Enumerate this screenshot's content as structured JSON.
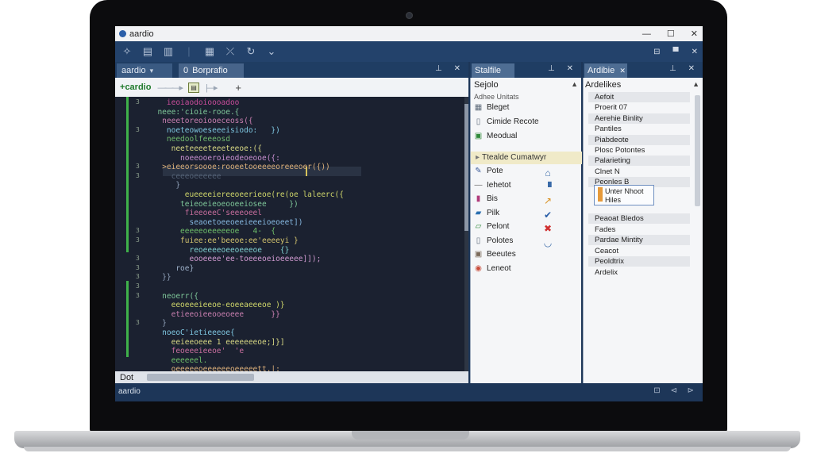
{
  "window": {
    "title": "aardio",
    "minimize": "—",
    "maximize": "☐",
    "close": "✕"
  },
  "toolbar": {
    "pin": "⊟",
    "restore": "▀",
    "close": "✕"
  },
  "editor": {
    "tabs": [
      {
        "label": "aardio",
        "marker": "▾"
      },
      {
        "label": "Borprafio",
        "marker": "0"
      }
    ],
    "pins": "⊥ ✕",
    "tool_label": "cardio",
    "footer_label": "Dot",
    "status_label": "aardio",
    "code_lines": [
      {
        "t": "    ieoiaodoioooadoo",
        "c": "#c94c9a"
      },
      {
        "t": "  neee:'cioie-rooe.{",
        "c": "#7fc89a"
      },
      {
        "t": "   neeetoreoiooeceoss({",
        "c": "#c97fb0"
      },
      {
        "t": "    noeteowoeseeeisiodo:   })",
        "c": "#7ec6e0"
      },
      {
        "t": "    needoolfeeeosd",
        "c": "#6fb86e"
      },
      {
        "t": "     neeteeeeteeeteeoe:({",
        "c": "#d8d884"
      },
      {
        "t": "       noeeooeroieodeoeooe({:",
        "c": "#c98fd0"
      },
      {
        "t": "   >eieeorsoooe:rooeetooeeeeoreeeoer({))",
        "c": "#dcb07a"
      },
      {
        "t": "     ceeeoeeeeee",
        "c": "#566478"
      },
      {
        "t": "      }",
        "c": "#8fa0b8"
      },
      {
        "t": "        eueeeeiereeoeerieoe(re(oe laleerc({",
        "c": "#cfd66a"
      },
      {
        "t": "       teieoeieoeooeeiosee     })",
        "c": "#7fc89a"
      },
      {
        "t": "        fieeoeeC'seeeoeel",
        "c": "#c96e9e"
      },
      {
        "t": "         seaoetoeeoeeieeeioeoeet])",
        "c": "#86b8e0"
      },
      {
        "t": "       eeeeeoeeeeeoe   4-  {",
        "c": "#6fbf6a"
      },
      {
        "t": "       fuiee:ee'beeoe:ee'eeeeyi }",
        "c": "#d3c36e"
      },
      {
        "t": "         reoeeeeoeeoeeeoe    {}",
        "c": "#7fd0d0"
      },
      {
        "t": "         eooeeee'ee-toeeeoeioeeeee]]);",
        "c": "#d09ad0"
      },
      {
        "t": "      roe}",
        "c": "#9db0c8"
      },
      {
        "t": "   }}",
        "c": "#8fa0b8"
      },
      {
        "t": "",
        "c": "#8fa0b8"
      },
      {
        "t": "   neoerr({",
        "c": "#7fc89a"
      },
      {
        "t": "     eeoeeeieeoe-eoeeaeeeoe )}",
        "c": "#cfd66a"
      },
      {
        "t": "     etieeoieeooeoeee      }}",
        "c": "#c97fb0"
      },
      {
        "t": "   }",
        "c": "#8fa0b8"
      },
      {
        "t": "   noeoC'ietieeeoe{",
        "c": "#7ec6e0"
      },
      {
        "t": "     eeieeoeee 1 eeeeeeeoe;]}]",
        "c": "#d8d884"
      },
      {
        "t": "     feoeeeieeoe'  'e",
        "c": "#c96e9e"
      },
      {
        "t": "     eeeeeel.",
        "c": "#6fbf6a"
      },
      {
        "t": "     oeeeeeoeeeeeeoeeeeett.|;",
        "c": "#dcb07a"
      }
    ],
    "gutter_marks": [
      {
        "n": "3",
        "line": 0
      },
      {
        "n": "3",
        "line": 3
      },
      {
        "n": "3",
        "line": 7
      },
      {
        "n": "3",
        "line": 8
      },
      {
        "n": "3",
        "line": 14
      },
      {
        "n": "3",
        "line": 15
      },
      {
        "n": "3",
        "line": 17
      },
      {
        "n": "3",
        "line": 18
      },
      {
        "n": "3",
        "line": 19
      },
      {
        "n": "3",
        "line": 20
      },
      {
        "n": "3",
        "line": 21
      },
      {
        "n": "3",
        "line": 24
      }
    ]
  },
  "middle_panel": {
    "tab_label": "Stalfile",
    "title": "Sejolo",
    "subtitle": "Adhee Unitats",
    "items_top": [
      {
        "label": "Bleget",
        "icon": "▦",
        "icon_color": "#5e6b7a"
      },
      {
        "label": "Cimide Recote",
        "icon": "▯",
        "icon_color": "#5e6b7a"
      },
      {
        "label": "Meodual",
        "icon": "▣",
        "icon_color": "#2f8a3a"
      }
    ],
    "selected_label": "Ttealde Cumatwyr",
    "items_bottom": [
      {
        "label": "Pote",
        "icon": "✎",
        "icon_color": "#3a5a9a"
      },
      {
        "label": "Iehetot",
        "icon": "—",
        "icon_color": "#6a6a6a"
      },
      {
        "label": "Bis",
        "icon": "▮",
        "icon_color": "#b03a7a"
      },
      {
        "label": "Pilk",
        "icon": "▰",
        "icon_color": "#2a6fb0"
      },
      {
        "label": "Pelont",
        "icon": "▱",
        "icon_color": "#2f8a3a"
      },
      {
        "label": "Polotes",
        "icon": "▯",
        "icon_color": "#5e6b7a"
      },
      {
        "label": "Beeutes",
        "icon": "▣",
        "icon_color": "#7a6a5a"
      },
      {
        "label": "Leneot",
        "icon": "◉",
        "icon_color": "#c94c3a"
      }
    ],
    "actions": [
      {
        "icon": "⌂",
        "color": "#3a6aa8"
      },
      {
        "icon": "▝",
        "color": "#3a6aa8"
      },
      {
        "icon": "↗",
        "color": "#d89020"
      },
      {
        "icon": "✔",
        "color": "#2a5ea8"
      },
      {
        "icon": "✖",
        "color": "#d03030"
      },
      {
        "icon": "◡",
        "color": "#3a6aa8"
      }
    ]
  },
  "right_panel": {
    "tab_label": "Ardibie",
    "title": "Ardelikes",
    "rows_top": [
      {
        "label": "Aefoit",
        "grey": true
      },
      {
        "label": "Proerit 07",
        "grey": false
      },
      {
        "label": "Aerehie Binlity",
        "grey": true
      },
      {
        "label": "Pantiles",
        "grey": false
      },
      {
        "label": "Piabdeote",
        "grey": true
      },
      {
        "label": "Plosc Potontes",
        "grey": false
      },
      {
        "label": "Palarieting",
        "grey": true
      },
      {
        "label": "Clnet N",
        "grey": false
      },
      {
        "label": "Peonles B",
        "grey": true
      }
    ],
    "card": {
      "line1": "Unter Nhoot",
      "line2": "Hiles"
    },
    "rows_bottom": [
      {
        "label": "Peaoat Bledos",
        "grey": true
      },
      {
        "label": "Fades",
        "grey": false
      },
      {
        "label": "Pardae Mintity",
        "grey": true
      },
      {
        "label": "Ceacot",
        "grey": false
      },
      {
        "label": "Peoldtrix",
        "grey": true
      },
      {
        "label": "Ardelix",
        "grey": false
      }
    ]
  },
  "colors": {
    "accent": "#1d3658",
    "editor_bg": "#1b2130",
    "gutter_green": "#3fb14a"
  }
}
